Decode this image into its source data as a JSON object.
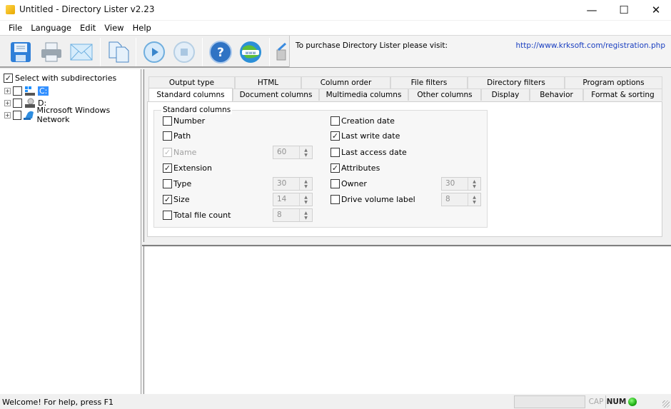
{
  "window": {
    "title": "Untitled - Directory Lister v2.23",
    "controls": {
      "minimize": "—",
      "maximize": "☐",
      "close": "✕"
    }
  },
  "menu": [
    "File",
    "Language",
    "Edit",
    "View",
    "Help"
  ],
  "toolbar": {
    "buttons": [
      "save-icon",
      "print-icon",
      "email-icon",
      "copy-icon",
      "start-icon",
      "stop-icon",
      "help-icon",
      "www-icon",
      "clear-icon"
    ],
    "promo_text": "To purchase Directory Lister please visit:",
    "promo_link": "http://www.krksoft.com/registration.php"
  },
  "tree": {
    "select_subdirs_label": "Select with subdirectories",
    "select_subdirs_checked": true,
    "items": [
      {
        "label": "C:",
        "selected": true,
        "checked": false
      },
      {
        "label": "D:",
        "selected": false,
        "checked": false
      },
      {
        "label": "Microsoft Windows Network",
        "selected": false,
        "checked": false
      }
    ]
  },
  "tabs": {
    "row1": [
      "Output type",
      "HTML",
      "Column order",
      "File filters",
      "Directory filters",
      "Program options"
    ],
    "row2": [
      "Standard columns",
      "Document columns",
      "Multimedia columns",
      "Other columns",
      "Display",
      "Behavior",
      "Format & sorting"
    ],
    "active": "Standard columns"
  },
  "standard_columns": {
    "group_label": "Standard columns",
    "left": [
      {
        "label": "Number",
        "checked": false,
        "enabled": true,
        "width": null
      },
      {
        "label": "Path",
        "checked": false,
        "enabled": true,
        "width": null
      },
      {
        "label": "Name",
        "checked": true,
        "enabled": false,
        "width": "60"
      },
      {
        "label": "Extension",
        "checked": true,
        "enabled": true,
        "width": null
      },
      {
        "label": "Type",
        "checked": false,
        "enabled": true,
        "width": "30"
      },
      {
        "label": "Size",
        "checked": true,
        "enabled": true,
        "width": "14"
      },
      {
        "label": "Total file count",
        "checked": false,
        "enabled": true,
        "width": "8"
      }
    ],
    "right": [
      {
        "label": "Creation date",
        "checked": false,
        "width": null
      },
      {
        "label": "Last write date",
        "checked": true,
        "width": null
      },
      {
        "label": "Last access date",
        "checked": false,
        "width": null
      },
      {
        "label": "Attributes",
        "checked": true,
        "width": null
      },
      {
        "label": "Owner",
        "checked": false,
        "width": "30"
      },
      {
        "label": "Drive volume label",
        "checked": false,
        "width": "8"
      }
    ]
  },
  "statusbar": {
    "message": "Welcome! For help, press F1",
    "cap": "CAP",
    "num": "NUM",
    "led_color": "#1fae14"
  },
  "colors": {
    "link": "#1a3fc0",
    "selection": "#3390ff"
  }
}
